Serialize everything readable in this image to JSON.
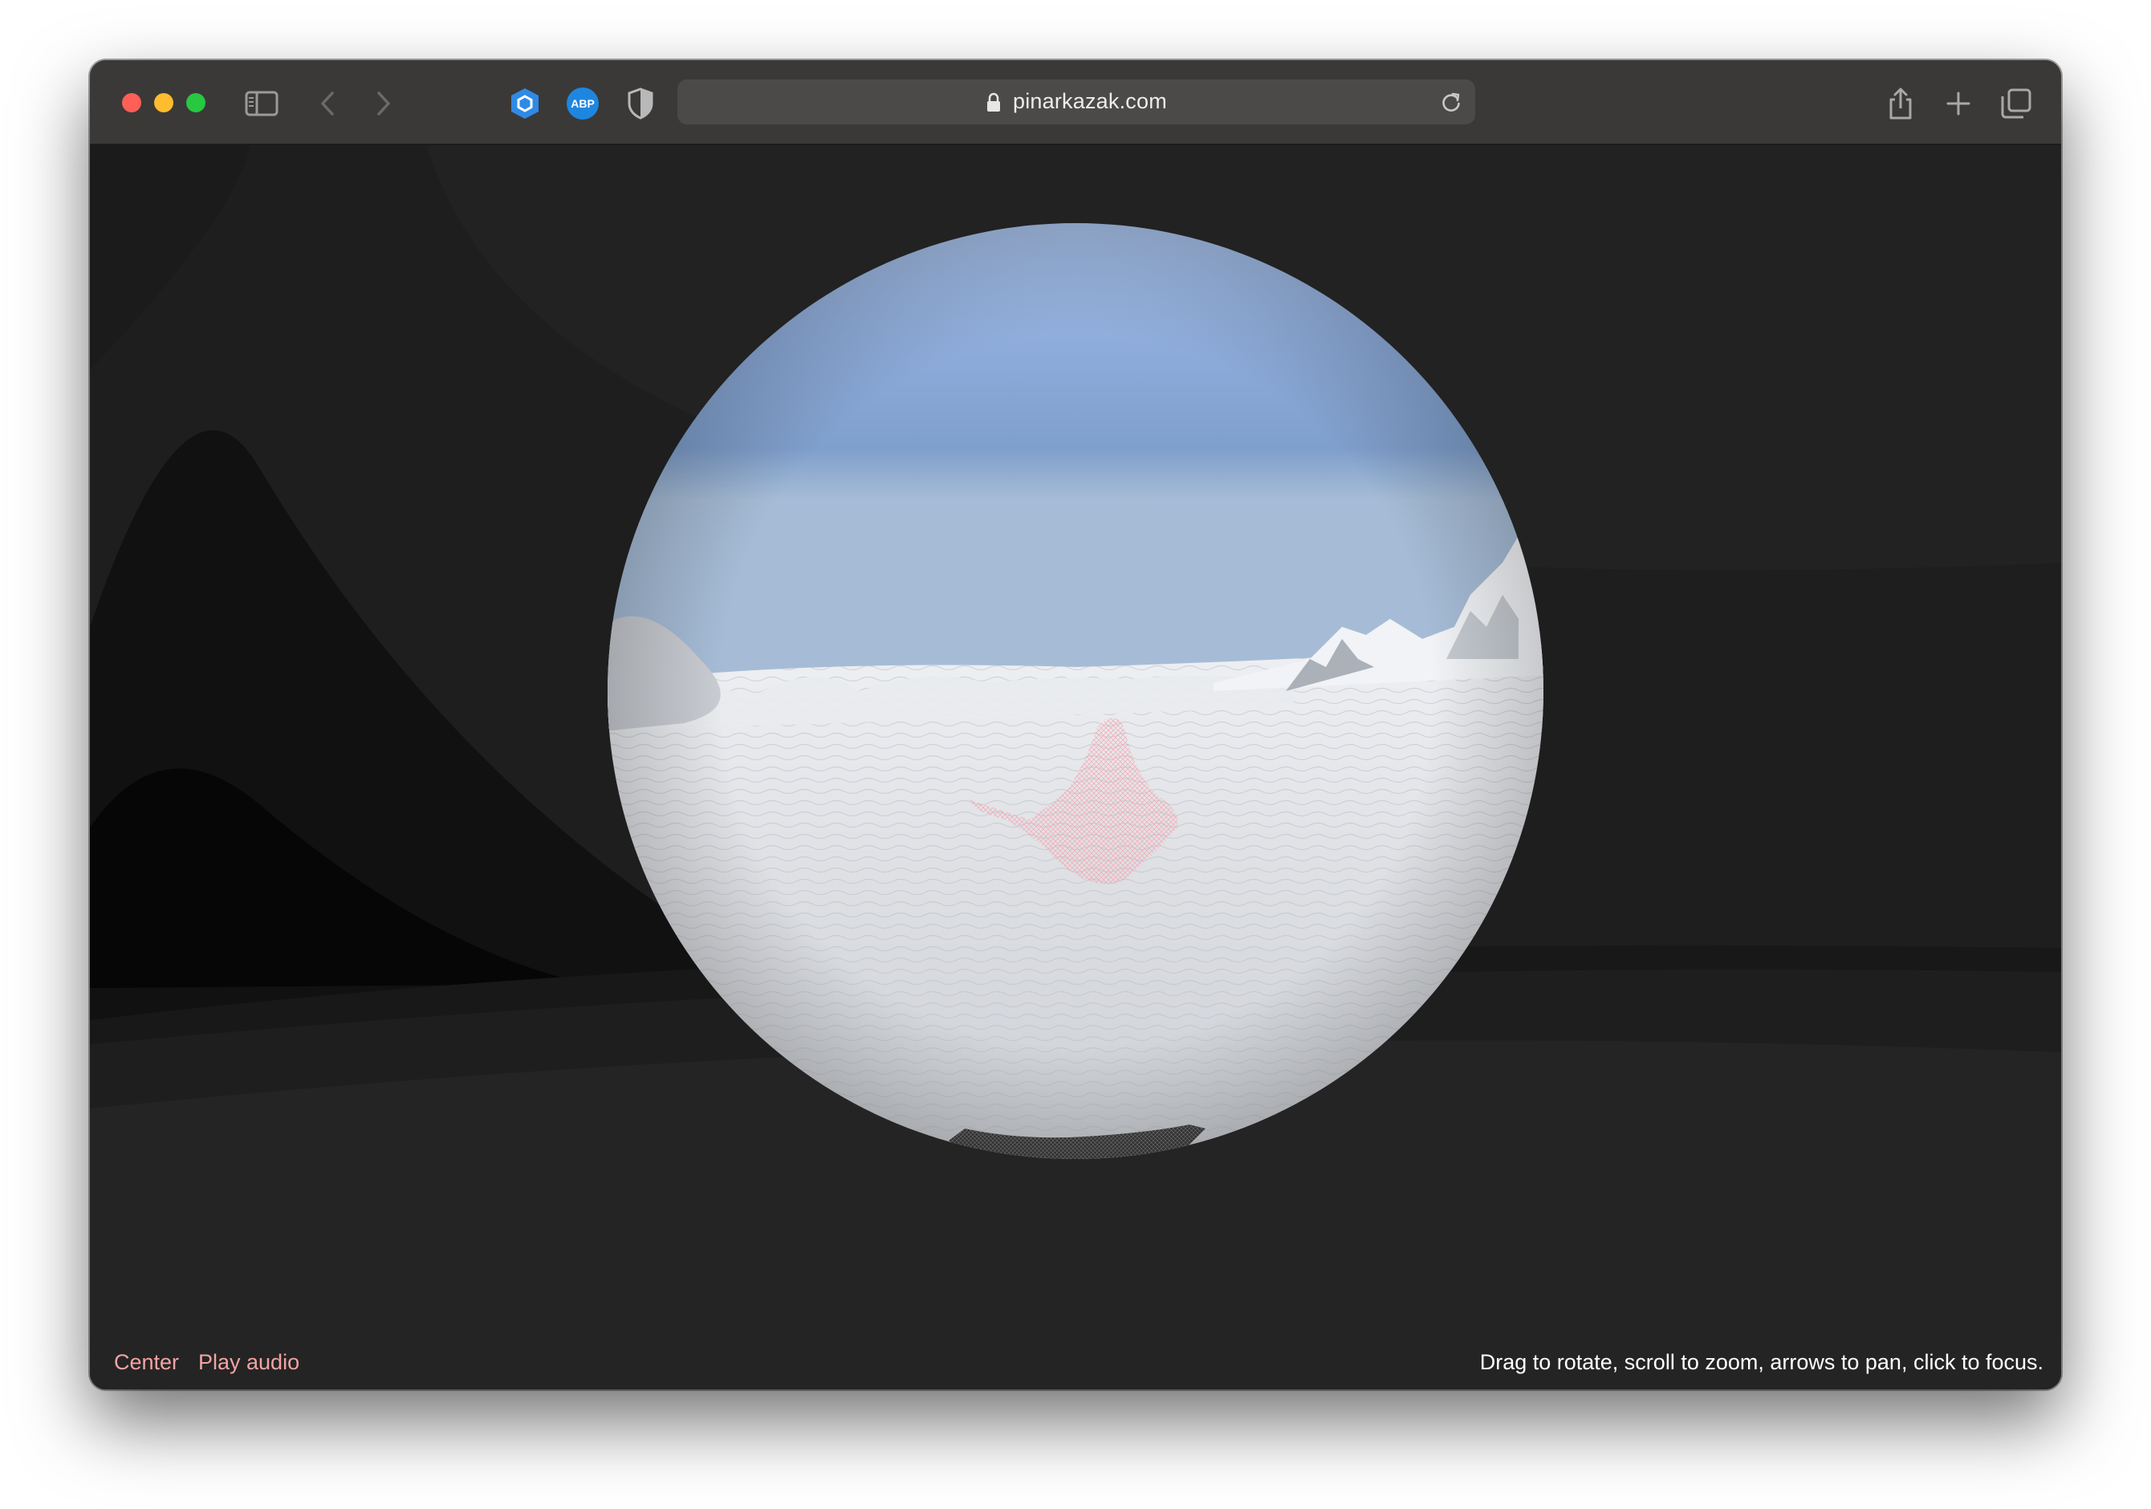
{
  "browser": {
    "url": "pinarkazak.com",
    "extensions": [
      {
        "name": "hexagon-extension-icon",
        "color": "#2f8ae6"
      },
      {
        "name": "adblock-plus-icon",
        "label": "ABP",
        "color": "#1f86e0"
      },
      {
        "name": "privacy-shield-icon"
      }
    ]
  },
  "page": {
    "controls": {
      "center_label": "Center",
      "play_audio_label": "Play audio"
    },
    "instructions": "Drag to rotate, scroll to zoom, arrows to pan, click to focus.",
    "accent_color": "#f4a3a3",
    "background_color": "#212121"
  },
  "panorama": {
    "scene": "snowfield-sky",
    "sky_color": "#8fb0dd",
    "snow_color": "#dcdee2",
    "overlay_color": "#f3a6b0"
  }
}
